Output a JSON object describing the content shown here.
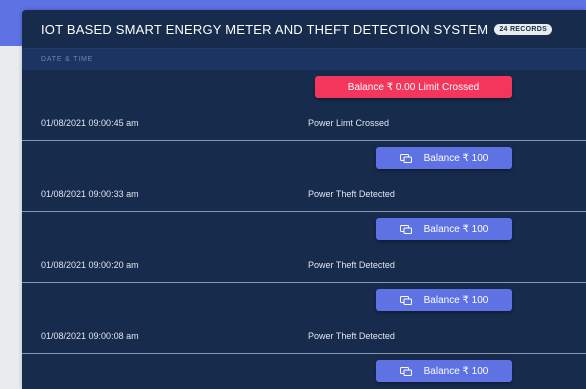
{
  "header": {
    "title": "IOT BASED SMART ENERGY METER AND THEFT DETECTION SYSTEM",
    "records_badge": "24 RECORDS"
  },
  "table": {
    "column_header": "DATE & TIME",
    "rows": [
      {
        "button_label": "Balance ₹ 0.00 Limit Crossed",
        "button_style": "danger",
        "date": "01/08/2021 09:00:45 am",
        "status": "Power Limt Crossed"
      },
      {
        "button_label": "Balance ₹ 100",
        "button_style": "primary",
        "date": "01/08/2021 09:00:33 am",
        "status": "Power Theft Detected"
      },
      {
        "button_label": "Balance ₹ 100",
        "button_style": "primary",
        "date": "01/08/2021 09:00:20 am",
        "status": "Power Theft Detected"
      },
      {
        "button_label": "Balance ₹ 100",
        "button_style": "primary",
        "date": "01/08/2021 09:00:08 am",
        "status": "Power Theft Detected"
      },
      {
        "button_label": "Balance ₹ 100",
        "button_style": "primary",
        "date": "",
        "status": ""
      }
    ]
  },
  "colors": {
    "card_bg": "#172b4d",
    "accent": "#5e72e4",
    "danger": "#f5365c"
  },
  "icons": {
    "balance_button": "wallet-icon"
  }
}
